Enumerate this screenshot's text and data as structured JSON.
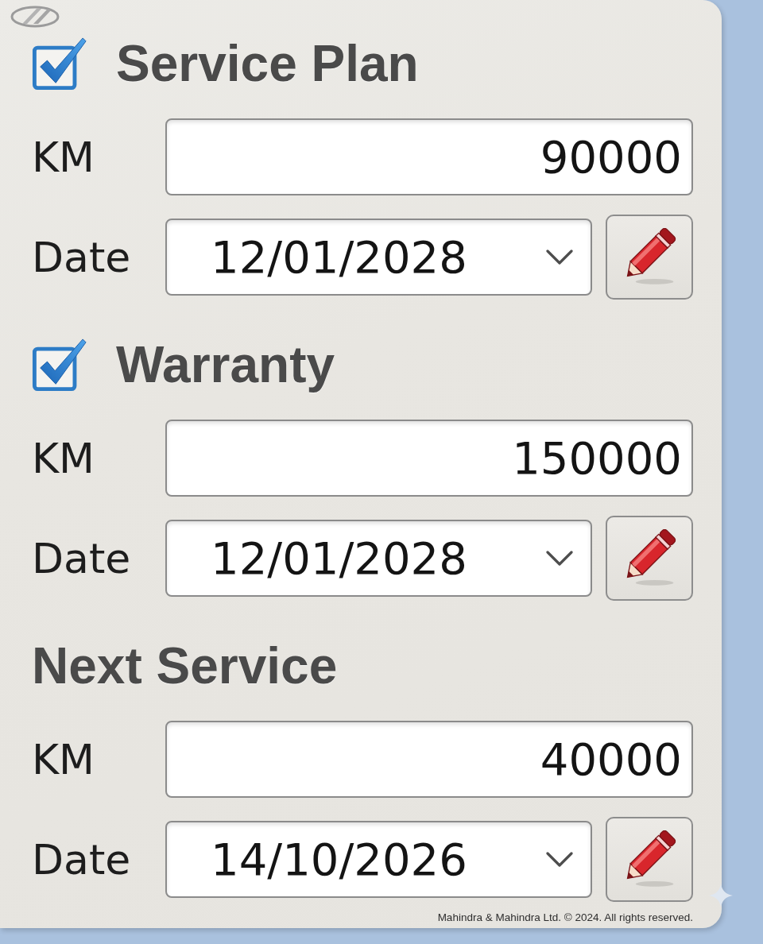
{
  "sections": [
    {
      "title": "Service Plan",
      "checkbox": {
        "checked": true
      },
      "fields": [
        {
          "kind": "number",
          "label": "KM",
          "value": "90000"
        },
        {
          "kind": "date",
          "label": "Date",
          "value": "12/01/2028"
        }
      ]
    },
    {
      "title": "Warranty",
      "checkbox": {
        "checked": true
      },
      "fields": [
        {
          "kind": "number",
          "label": "KM",
          "value": "150000"
        },
        {
          "kind": "date",
          "label": "Date",
          "value": "12/01/2028"
        }
      ]
    },
    {
      "title": "Next Service",
      "fields": [
        {
          "kind": "number",
          "label": "KM",
          "value": "40000"
        },
        {
          "kind": "date",
          "label": "Date",
          "value": "14/10/2026"
        }
      ]
    }
  ],
  "footer": "Mahindra & Mahindra Ltd. © 2024. All rights reserved."
}
